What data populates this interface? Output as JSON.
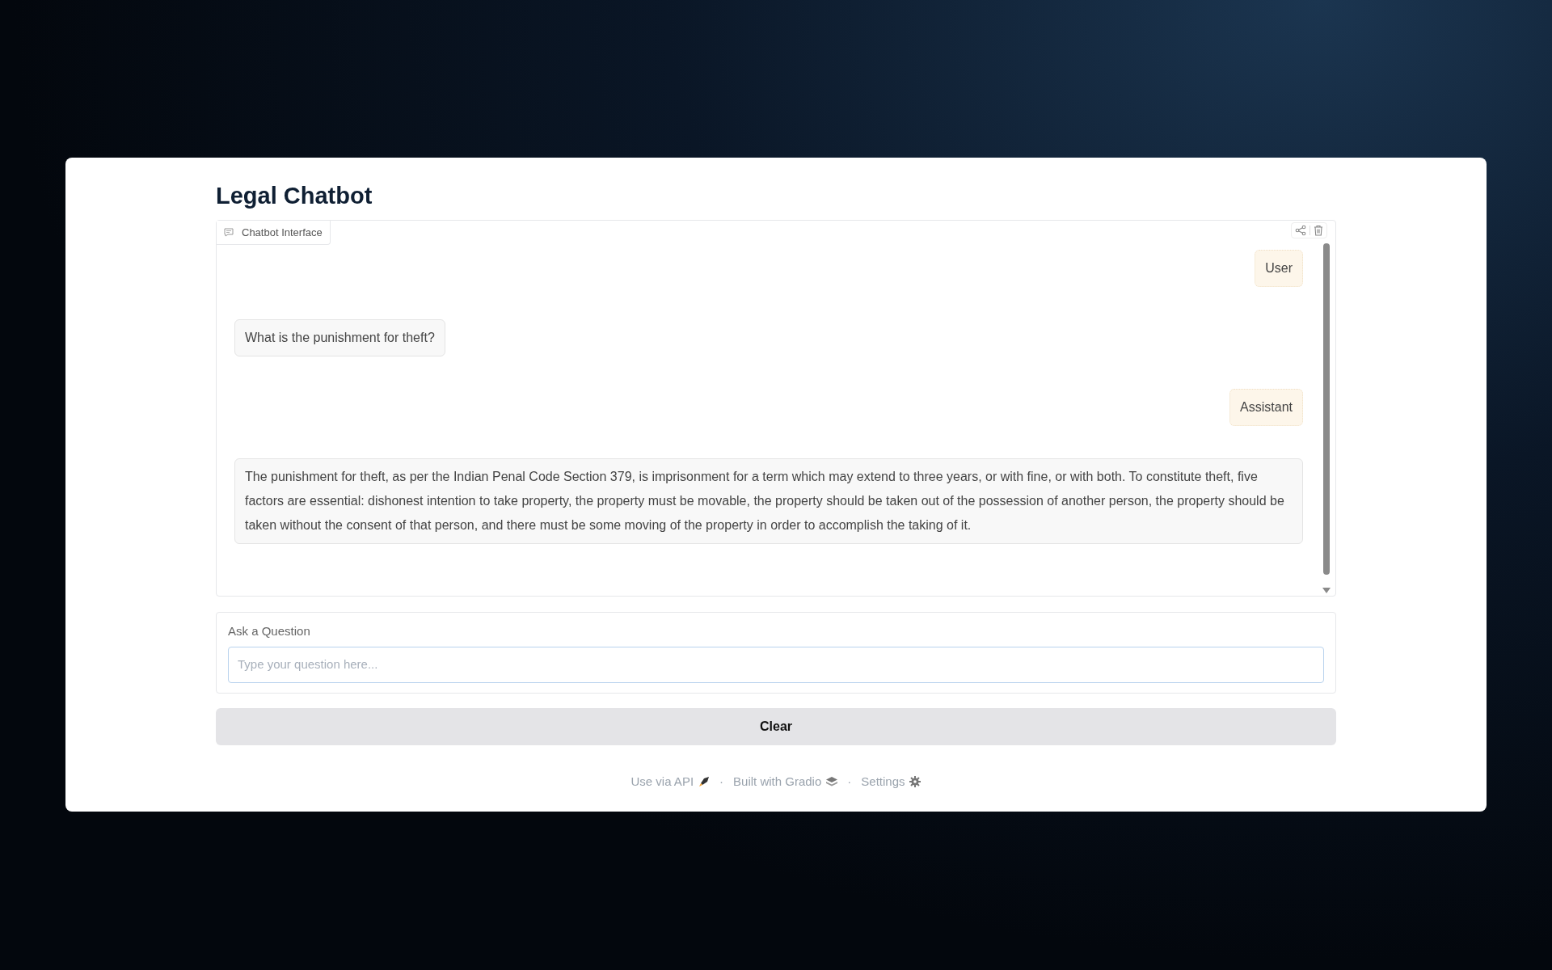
{
  "title": "Legal Chatbot",
  "chatbot": {
    "label": "Chatbot Interface",
    "messages": [
      {
        "kind": "user",
        "text": "User"
      },
      {
        "kind": "bot",
        "text": "What is the punishment for theft?"
      },
      {
        "kind": "user",
        "text": "Assistant"
      },
      {
        "kind": "bot",
        "text": "The punishment for theft, as per the Indian Penal Code Section 379, is imprisonment for a term which may extend to three years, or with fine, or with both. To constitute theft, five factors are essential: dishonest intention to take property, the property must be movable, the property should be taken out of the possession of another person, the property should be taken without the consent of that person, and there must be some moving of the property in order to accomplish the taking of it."
      }
    ]
  },
  "question": {
    "label": "Ask a Question",
    "placeholder": "Type your question here..."
  },
  "clear_button": "Clear",
  "footer": [
    {
      "kind": "api",
      "text": "Use via API"
    },
    {
      "kind": "separator",
      "text": "·"
    },
    {
      "kind": "gradio",
      "text": "Built with Gradio"
    },
    {
      "kind": "separator",
      "text": "·"
    },
    {
      "kind": "settings",
      "text": "Settings"
    }
  ]
}
